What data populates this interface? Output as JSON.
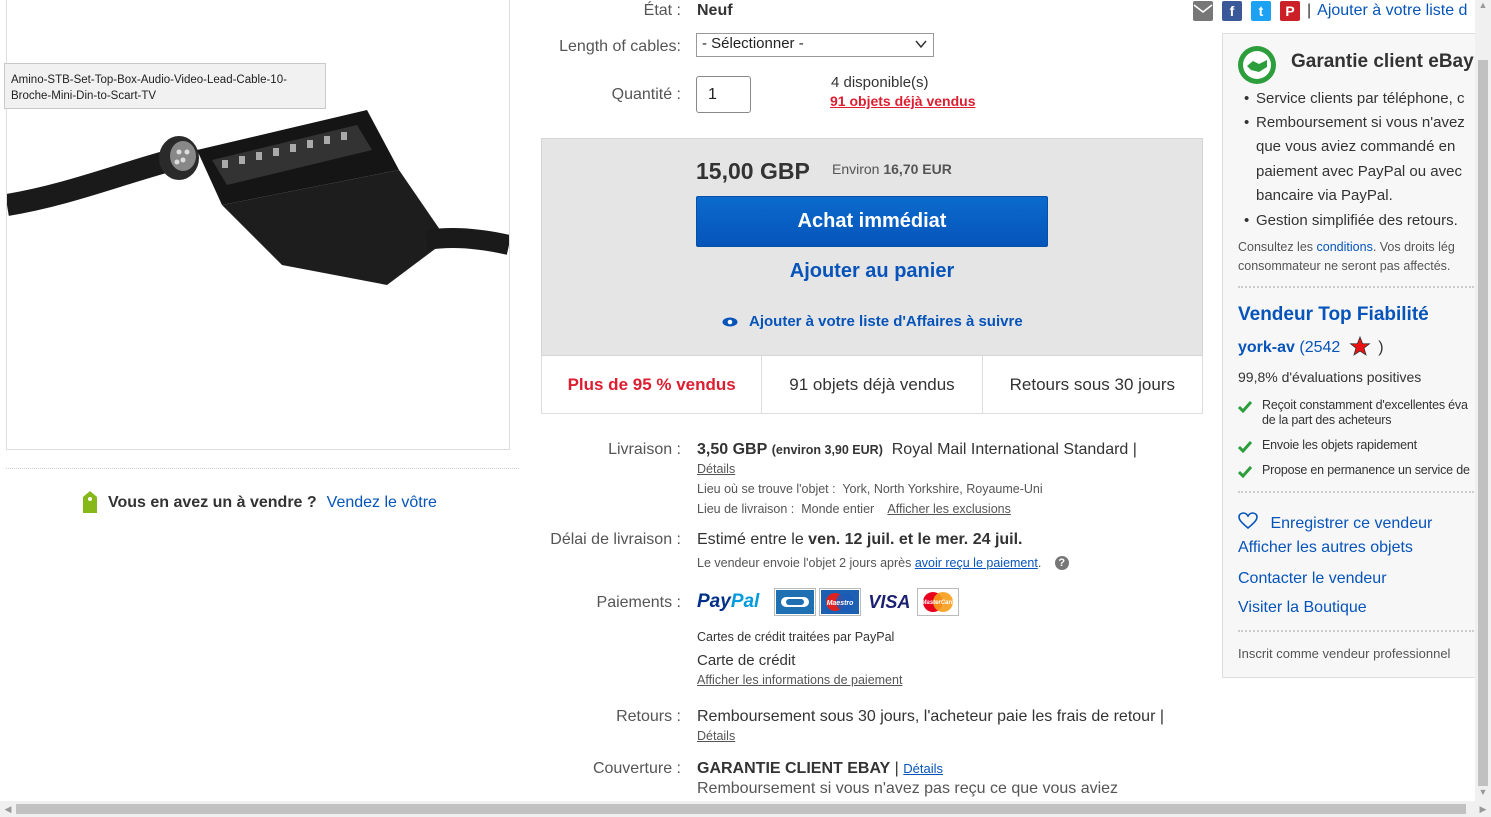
{
  "image": {
    "tooltip": "Amino-STB-Set-Top-Box-Audio-Video-Lead-Cable-10-Broche-Mini-Din-to-Scart-TV"
  },
  "sell": {
    "question": "Vous en avez un à vendre ?",
    "link": "Vendez le vôtre"
  },
  "item": {
    "condition_label": "État :",
    "condition_value": "Neuf",
    "cables_label": "Length of cables:",
    "cables_selected": "- Sélectionner -",
    "quantity_label": "Quantité :",
    "quantity_value": "1",
    "available": "4 disponible(s)",
    "sold_link": "91 objets déjà vendus"
  },
  "buy": {
    "price": "15,00 GBP",
    "approx_prefix": "Environ",
    "approx_value": "16,70 EUR",
    "buy_now": "Achat immédiat",
    "add_to_cart": "Ajouter au panier",
    "watch": "Ajouter à votre liste d'Affaires à suivre"
  },
  "stats": [
    "Plus de 95 % vendus",
    "91 objets déjà vendus",
    "Retours sous 30 jours"
  ],
  "shipping": {
    "label": "Livraison :",
    "price": "3,50 GBP",
    "approx": "(environ 3,90 EUR)",
    "service": "Royal Mail International Standard |",
    "details": "Détails",
    "location_label": "Lieu où se trouve l'objet :",
    "location": "York, North Yorkshire, Royaume-Uni",
    "dest_label": "Lieu de livraison :",
    "dest": "Monde entier",
    "exclusions": "Afficher les exclusions"
  },
  "delivery": {
    "label": "Délai de livraison :",
    "prefix": "Estimé entre le",
    "dates": "ven. 12 juil. et le mer. 24 juil.",
    "note_prefix": "Le vendeur envoie l'objet 2 jours après",
    "note_link": "avoir reçu le paiement",
    "note_end": "."
  },
  "payments": {
    "label": "Paiements :",
    "logos": [
      "PayPal",
      "CB",
      "Maestro",
      "VISA",
      "MasterCard"
    ],
    "credit_note": "Cartes de crédit traitées par PayPal",
    "credit_card": "Carte de crédit",
    "info_link": "Afficher les informations de paiement"
  },
  "returns": {
    "label": "Retours :",
    "text": "Remboursement sous 30 jours, l'acheteur paie les frais de retour |",
    "details": "Détails"
  },
  "coverage": {
    "label": "Couverture :",
    "title": "GARANTIE CLIENT EBAY",
    "sep": "|",
    "details": "Détails",
    "text": "Remboursement si vous n'avez pas reçu ce que vous aviez"
  },
  "top_actions": {
    "watch": "Ajouter à votre liste d",
    "bar": "|"
  },
  "guarantee": {
    "title": "Garantie client eBay",
    "bullets": [
      "Service clients par téléphone, c",
      "Remboursement si vous n'avez",
      "que vous aviez commandé en",
      "paiement avec PayPal ou avec",
      "bancaire via PayPal.",
      "Gestion simplifiée des retours."
    ],
    "terms_prefix": "Consultez les",
    "terms_link": "conditions",
    "terms_suffix": ". Vos droits lég",
    "terms_line2": "consommateur ne seront pas affectés."
  },
  "seller": {
    "badge": "Vendeur Top Fiabilité",
    "name": "york-av",
    "score": "(2542",
    "score_close": ")",
    "positive": "99,8% d'évaluations positives",
    "checks": [
      "Reçoit constamment d'excellentes éva",
      "de la part des acheteurs",
      "Envoie les objets rapidement",
      "Propose en permanence un service de"
    ],
    "save": "Enregistrer ce vendeur",
    "other_items": "Afficher les autres objets",
    "contact": "Contacter le vendeur",
    "store": "Visiter la Boutique",
    "pro": "Inscrit comme vendeur professionnel"
  },
  "colors": {
    "link": "#0654ba",
    "buy_button": "#0654ba",
    "sold_red": "#dd1e31",
    "panel_bg": "#e5e5e5"
  }
}
